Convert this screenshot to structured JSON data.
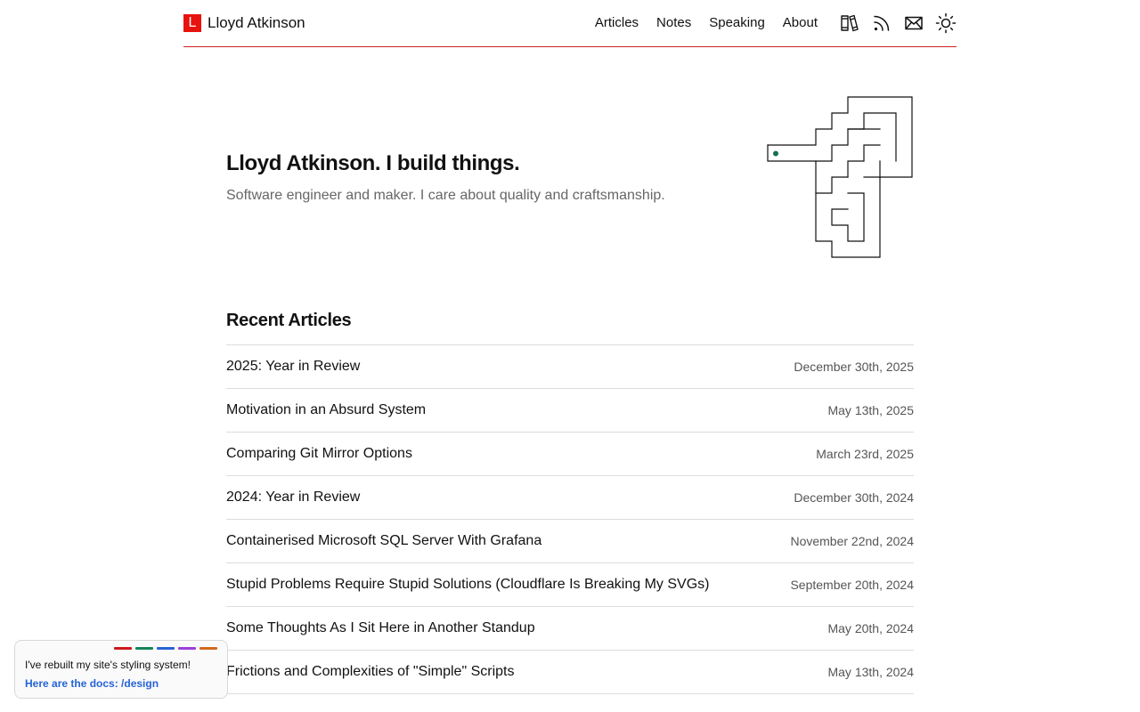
{
  "header": {
    "logo_letter": "L",
    "site_name": "Lloyd Atkinson",
    "nav": [
      {
        "label": "Articles"
      },
      {
        "label": "Notes"
      },
      {
        "label": "Speaking"
      },
      {
        "label": "About"
      }
    ],
    "icons": [
      "books-icon",
      "rss-icon",
      "mail-icon",
      "sun-icon"
    ]
  },
  "hero": {
    "title": "Lloyd Atkinson. I build things.",
    "subtitle": "Software engineer and maker. I care about quality and craftsmanship."
  },
  "recent_articles": {
    "heading": "Recent Articles",
    "items": [
      {
        "title": "2025: Year in Review",
        "date": "December 30th, 2025"
      },
      {
        "title": "Motivation in an Absurd System",
        "date": "May 13th, 2025"
      },
      {
        "title": "Comparing Git Mirror Options",
        "date": "March 23rd, 2025"
      },
      {
        "title": "2024: Year in Review",
        "date": "December 30th, 2024"
      },
      {
        "title": "Containerised Microsoft SQL Server With Grafana",
        "date": "November 22nd, 2024"
      },
      {
        "title": "Stupid Problems Require Stupid Solutions (Cloudflare Is Breaking My SVGs)",
        "date": "September 20th, 2024"
      },
      {
        "title": "Some Thoughts As I Sit Here in Another Standup",
        "date": "May 20th, 2024"
      },
      {
        "title": "Frictions and Complexities of \"Simple\" Scripts",
        "date": "May 13th, 2024"
      }
    ]
  },
  "toast": {
    "message": "I've rebuilt my site's styling system!",
    "link": "Here are the docs: /design",
    "swatch_colors": [
      "#cc1a1a",
      "#14855a",
      "#2563d6",
      "#9b3fd8",
      "#d2691e"
    ]
  },
  "colors": {
    "accent": "#e8120f",
    "divider": "#cc2222",
    "link": "#2563d6",
    "maze_dot": "#14704f"
  }
}
